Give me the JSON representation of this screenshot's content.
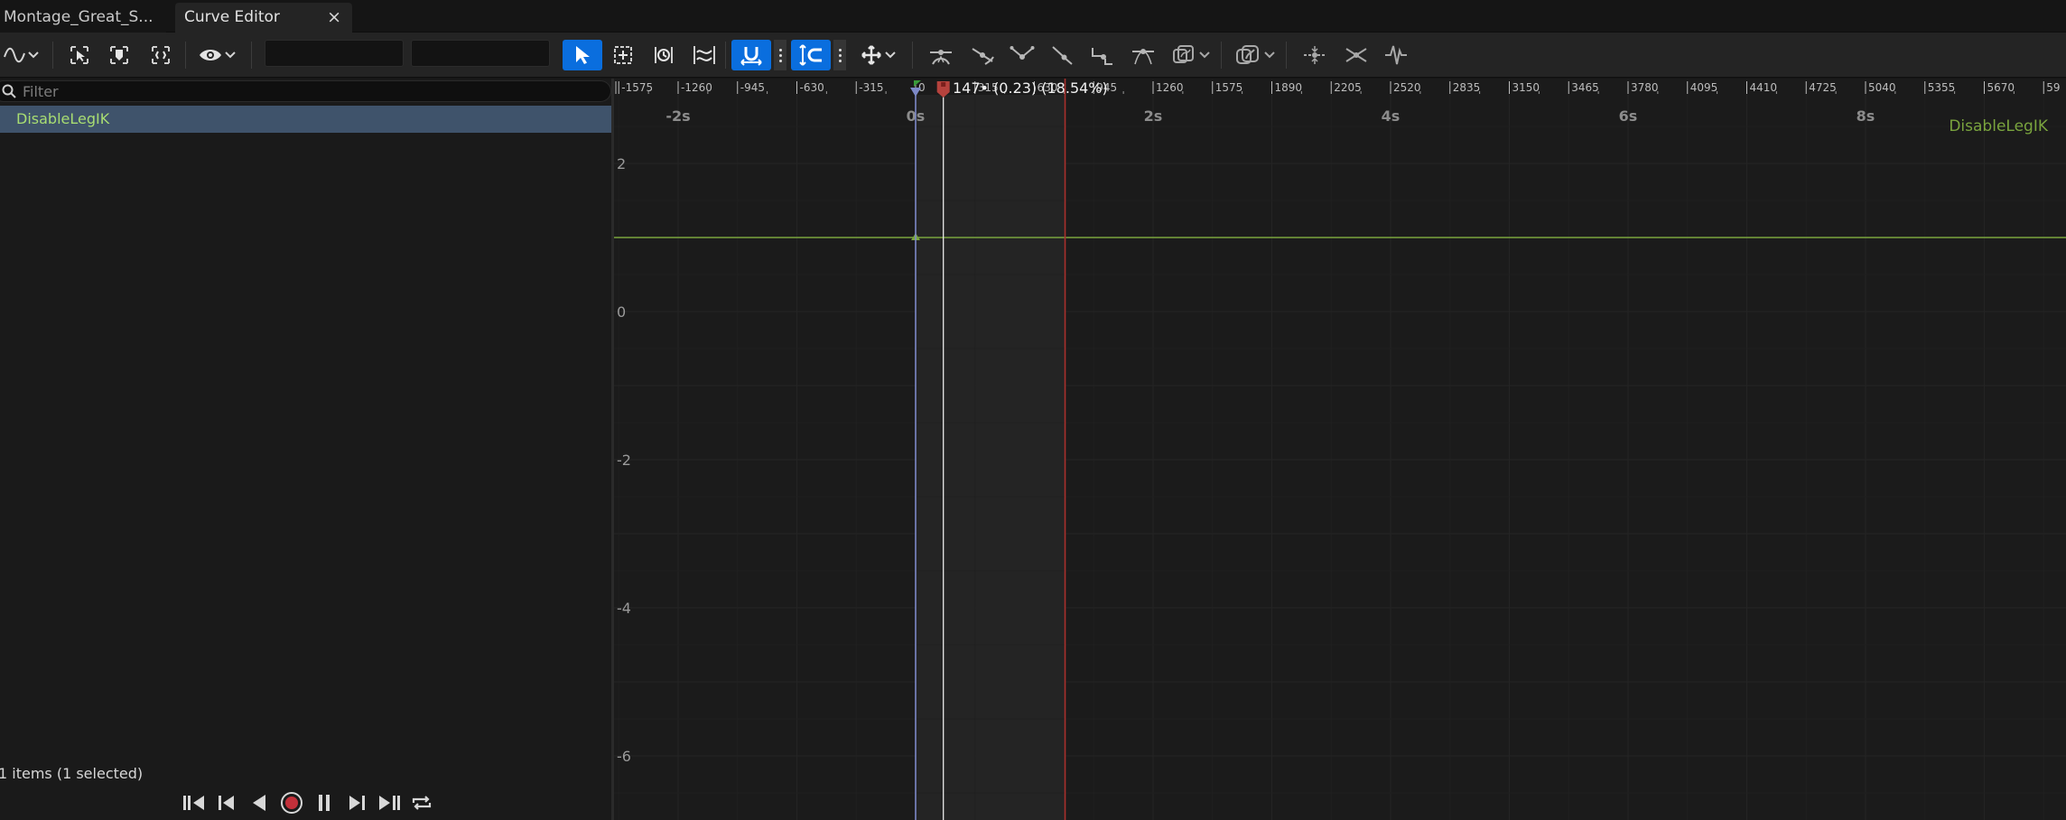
{
  "tabs": [
    {
      "label": "Montage_Great_S..."
    },
    {
      "label": "Curve Editor",
      "close": "×"
    }
  ],
  "toolbar": {
    "icons": [
      "curve-view-icon",
      "select-keys-icon",
      "key-icon",
      "frame-selection-icon",
      "visibility-icon",
      "select-tool-icon",
      "transform-tool-icon",
      "retime-tool-icon",
      "multi-scale-tool-icon",
      "snap-time-icon",
      "snap-value-icon",
      "axis-snap-icon",
      "auto-tangent-icon",
      "user-tangent-icon",
      "break-tangent-icon",
      "linear-tangent-icon",
      "constant-tangent-icon",
      "weighted-tangent-icon",
      "curve-filter-icon",
      "tangent-visibility-icon",
      "flatten-icon",
      "straighten-icon",
      "bake-icon"
    ],
    "time_snap_field": "",
    "value_snap_field": "",
    "accent": "#0a6ede"
  },
  "tree": {
    "filter_placeholder": "Filter",
    "items": [
      {
        "label": "DisableLegIK",
        "selected": true
      }
    ],
    "status": "1 items (1 selected)",
    "transport": [
      "jump-to-start-icon",
      "step-back-icon",
      "play-reverse-icon",
      "record-icon",
      "pause-icon",
      "step-forward-icon",
      "jump-to-end-icon",
      "loop-icon"
    ]
  },
  "graph": {
    "curve_label": "DisableLegIK",
    "curve_value": 1,
    "curve_color": "#7aa43e",
    "playhead_label": "147• (0.23) (18.54%)",
    "playhead_frame": 147,
    "frame_ticks": [
      -1575,
      -1260,
      -945,
      -630,
      -315,
      0,
      315,
      630,
      945,
      1260,
      1575,
      1890,
      2205,
      2520,
      2835,
      3150,
      3465,
      3780,
      4095,
      4410,
      4725,
      5040,
      5355,
      5670
    ],
    "frame_ticks_cut": "59",
    "second_labels": [
      "-2s",
      "0s",
      "2s",
      "4s",
      "6s",
      "8s"
    ],
    "second_values": [
      -2,
      0,
      2,
      4,
      6,
      8
    ],
    "y_labels": [
      "2",
      "0",
      "-2",
      "-4",
      "-6"
    ],
    "y_values": [
      2,
      0,
      -2,
      -4,
      -6
    ],
    "range_start_frame": 0,
    "range_end_frame": 793
  }
}
